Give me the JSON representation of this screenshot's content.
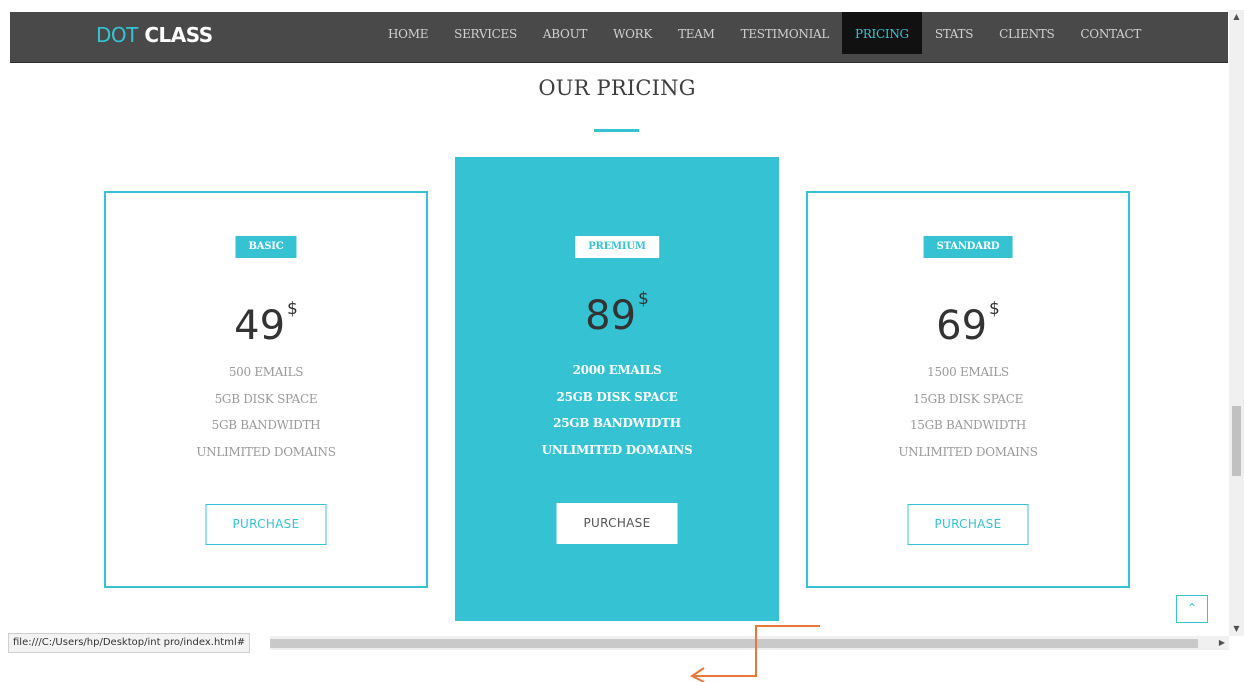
{
  "brand": {
    "part1": "DOT",
    "part2": "CLASS"
  },
  "nav": [
    {
      "label": "HOME",
      "active": false
    },
    {
      "label": "SERVICES",
      "active": false
    },
    {
      "label": "ABOUT",
      "active": false
    },
    {
      "label": "WORK",
      "active": false
    },
    {
      "label": "TEAM",
      "active": false
    },
    {
      "label": "TESTIMONIAL",
      "active": false
    },
    {
      "label": "PRICING",
      "active": true
    },
    {
      "label": "STATS",
      "active": false
    },
    {
      "label": "CLIENTS",
      "active": false
    },
    {
      "label": "CONTACT",
      "active": false
    }
  ],
  "section": {
    "title": "OUR PRICING"
  },
  "plans": [
    {
      "name": "BASIC",
      "price": "49",
      "currency": "$",
      "features": [
        "500 EMAILS",
        "5GB DISK SPACE",
        "5GB BANDWIDTH",
        "UNLIMITED DOMAINS"
      ],
      "button": "PURCHASE"
    },
    {
      "name": "PREMIUM",
      "price": "89",
      "currency": "$",
      "features": [
        "2000 EMAILS",
        "25GB DISK SPACE",
        "25GB BANDWIDTH",
        "UNLIMITED DOMAINS"
      ],
      "button": "PURCHASE"
    },
    {
      "name": "STANDARD",
      "price": "69",
      "currency": "$",
      "features": [
        "1500 EMAILS",
        "15GB DISK SPACE",
        "15GB BANDWIDTH",
        "UNLIMITED DOMAINS"
      ],
      "button": "PURCHASE"
    }
  ],
  "status_url": "file:///C:/Users/hp/Desktop/int pro/index.html#",
  "colors": {
    "accent": "#35c3d4",
    "navbar": "#494949",
    "arrow": "#e8773a"
  },
  "icons": {
    "back_to_top": "chevron-up-icon",
    "annotation": "arrow-left-icon"
  }
}
